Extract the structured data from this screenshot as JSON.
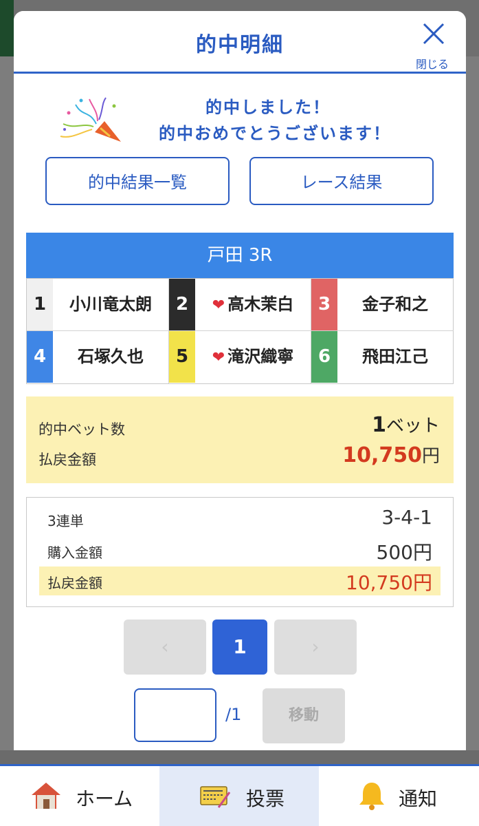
{
  "modal": {
    "title": "的中明細",
    "close_label": "閉じる"
  },
  "congrats": {
    "line1": "的中しました！",
    "line2": "的中おめでとうございます！"
  },
  "buttons": {
    "result_list": "的中結果一覧",
    "race_result": "レース結果"
  },
  "race": {
    "title": "戸田 3R",
    "racers": [
      {
        "num": "1",
        "name": "小川竜太朗",
        "favorite": false,
        "color": "#f0f0f0",
        "text_color": "#222222"
      },
      {
        "num": "2",
        "name": "高木茉白",
        "favorite": true,
        "color": "#2b2b2b",
        "text_color": "#ffffff"
      },
      {
        "num": "3",
        "name": "金子和之",
        "favorite": false,
        "color": "#e06464",
        "text_color": "#ffffff"
      },
      {
        "num": "4",
        "name": "石塚久也",
        "favorite": false,
        "color": "#3f86e6",
        "text_color": "#ffffff"
      },
      {
        "num": "5",
        "name": "滝沢織寧",
        "favorite": true,
        "color": "#f2e24a",
        "text_color": "#222222"
      },
      {
        "num": "6",
        "name": "飛田江己",
        "favorite": false,
        "color": "#4ea865",
        "text_color": "#ffffff"
      }
    ]
  },
  "summary": {
    "bets_label": "的中ベット数",
    "bets_value": "1",
    "bets_unit": "ベット",
    "payout_label": "払戻金額",
    "payout_value": "10,750",
    "payout_unit": "円"
  },
  "detail": {
    "type_label": "3連単",
    "type_value": "3-4-1",
    "purchase_label": "購入金額",
    "purchase_value": "500円",
    "payout_label": "払戻金額",
    "payout_value": "10,750円"
  },
  "pager": {
    "prev": "‹",
    "current": "1",
    "next": "›",
    "total": "/1",
    "move_label": "移動"
  },
  "nav": {
    "home": "ホーム",
    "vote": "投票",
    "notify": "通知"
  },
  "colors": {
    "accent": "#2a5bc1",
    "race_header": "#3a86e6",
    "highlight": "#fcf1b4",
    "payout_red": "#d33a1f"
  }
}
